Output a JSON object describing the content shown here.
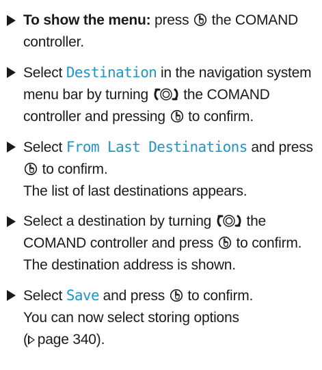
{
  "steps": [
    {
      "label": "To show the menu:",
      "text1": "press",
      "text2": "the COMAND controller."
    },
    {
      "text1": "Select",
      "hl": "Destination",
      "text2": "in the navigation system menu bar by turning",
      "text3": "the COMAND controller and pressing",
      "text4": "to confirm."
    },
    {
      "text1": "Select",
      "hl": "From Last Destinations",
      "text2": "and press",
      "text3": "to confirm.",
      "result": "The list of last destinations appears."
    },
    {
      "text1": "Select a destination by turning",
      "text2": "the COMAND controller and press",
      "text3": "to confirm.",
      "result": "The destination address is shown."
    },
    {
      "text1": "Select",
      "hl": "Save",
      "text2": "and press",
      "text3": "to confirm.",
      "result": "You can now select storing options",
      "ref_open": "(",
      "ref": "page 340).",
      "ref_full": "(▷ page 340)."
    }
  ],
  "icons": {
    "press": "press-controller-icon",
    "turn": "turn-controller-icon",
    "bullet": "triangle-bullet-icon",
    "reference": "page-reference-arrow-icon"
  },
  "colors": {
    "text": "#1a1a1a",
    "highlight": "#1e94c8"
  }
}
